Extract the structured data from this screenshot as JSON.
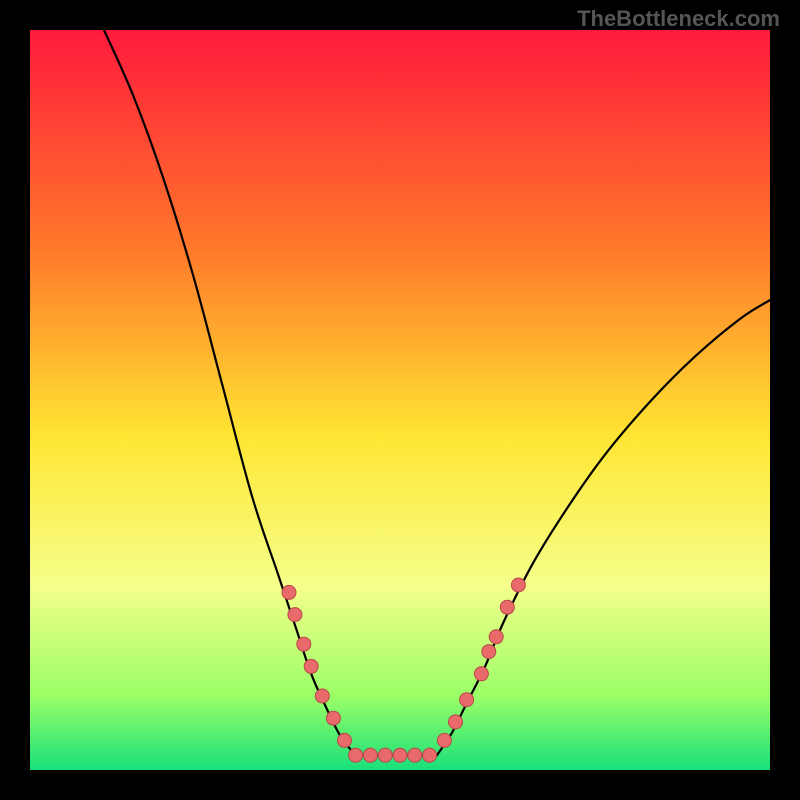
{
  "watermark": "TheBottleneck.com",
  "chart_data": {
    "type": "line",
    "title": "",
    "xlabel": "",
    "ylabel": "",
    "xlim": [
      0,
      100
    ],
    "ylim": [
      0,
      100
    ],
    "gradient_stops": [
      {
        "offset": 0,
        "color": "#ff1a3c"
      },
      {
        "offset": 30,
        "color": "#ff7a2a"
      },
      {
        "offset": 55,
        "color": "#ffe633"
      },
      {
        "offset": 75,
        "color": "#f5ff8a"
      },
      {
        "offset": 90,
        "color": "#9bff66"
      },
      {
        "offset": 100,
        "color": "#18e07a"
      }
    ],
    "series": [
      {
        "name": "left-curve",
        "type": "line",
        "points": [
          {
            "x": 10.0,
            "y": 100.0
          },
          {
            "x": 14.0,
            "y": 91.0
          },
          {
            "x": 18.0,
            "y": 80.0
          },
          {
            "x": 22.0,
            "y": 67.0
          },
          {
            "x": 26.0,
            "y": 52.0
          },
          {
            "x": 30.0,
            "y": 37.0
          },
          {
            "x": 33.5,
            "y": 26.5
          },
          {
            "x": 36.0,
            "y": 19.0
          },
          {
            "x": 38.0,
            "y": 13.0
          },
          {
            "x": 40.0,
            "y": 8.5
          },
          {
            "x": 42.0,
            "y": 4.5
          },
          {
            "x": 44.0,
            "y": 2.0
          }
        ]
      },
      {
        "name": "flat-segment",
        "type": "line",
        "points": [
          {
            "x": 44.0,
            "y": 2.0
          },
          {
            "x": 55.0,
            "y": 2.0
          }
        ]
      },
      {
        "name": "right-curve",
        "type": "line",
        "points": [
          {
            "x": 55.0,
            "y": 2.0
          },
          {
            "x": 57.0,
            "y": 5.0
          },
          {
            "x": 59.0,
            "y": 9.0
          },
          {
            "x": 61.5,
            "y": 14.0
          },
          {
            "x": 64.0,
            "y": 20.0
          },
          {
            "x": 68.0,
            "y": 28.0
          },
          {
            "x": 73.0,
            "y": 36.0
          },
          {
            "x": 78.0,
            "y": 43.0
          },
          {
            "x": 84.0,
            "y": 50.0
          },
          {
            "x": 90.0,
            "y": 56.0
          },
          {
            "x": 96.0,
            "y": 61.0
          },
          {
            "x": 100.0,
            "y": 63.5
          }
        ]
      },
      {
        "name": "dots-left",
        "type": "scatter",
        "points": [
          {
            "x": 35.0,
            "y": 24.0
          },
          {
            "x": 35.8,
            "y": 21.0
          },
          {
            "x": 37.0,
            "y": 17.0
          },
          {
            "x": 38.0,
            "y": 14.0
          },
          {
            "x": 39.5,
            "y": 10.0
          },
          {
            "x": 41.0,
            "y": 7.0
          },
          {
            "x": 42.5,
            "y": 4.0
          }
        ]
      },
      {
        "name": "dots-flat",
        "type": "scatter",
        "points": [
          {
            "x": 44.0,
            "y": 2.0
          },
          {
            "x": 46.0,
            "y": 2.0
          },
          {
            "x": 48.0,
            "y": 2.0
          },
          {
            "x": 50.0,
            "y": 2.0
          },
          {
            "x": 52.0,
            "y": 2.0
          },
          {
            "x": 54.0,
            "y": 2.0
          }
        ]
      },
      {
        "name": "dots-right",
        "type": "scatter",
        "points": [
          {
            "x": 56.0,
            "y": 4.0
          },
          {
            "x": 57.5,
            "y": 6.5
          },
          {
            "x": 59.0,
            "y": 9.5
          },
          {
            "x": 61.0,
            "y": 13.0
          },
          {
            "x": 62.0,
            "y": 16.0
          },
          {
            "x": 63.0,
            "y": 18.0
          },
          {
            "x": 64.5,
            "y": 22.0
          },
          {
            "x": 66.0,
            "y": 25.0
          }
        ]
      }
    ],
    "curve_stroke": "#000000",
    "curve_width": 2.2,
    "dot_fill": "#e86a6a",
    "dot_stroke": "#b84848",
    "dot_radius": 7
  }
}
